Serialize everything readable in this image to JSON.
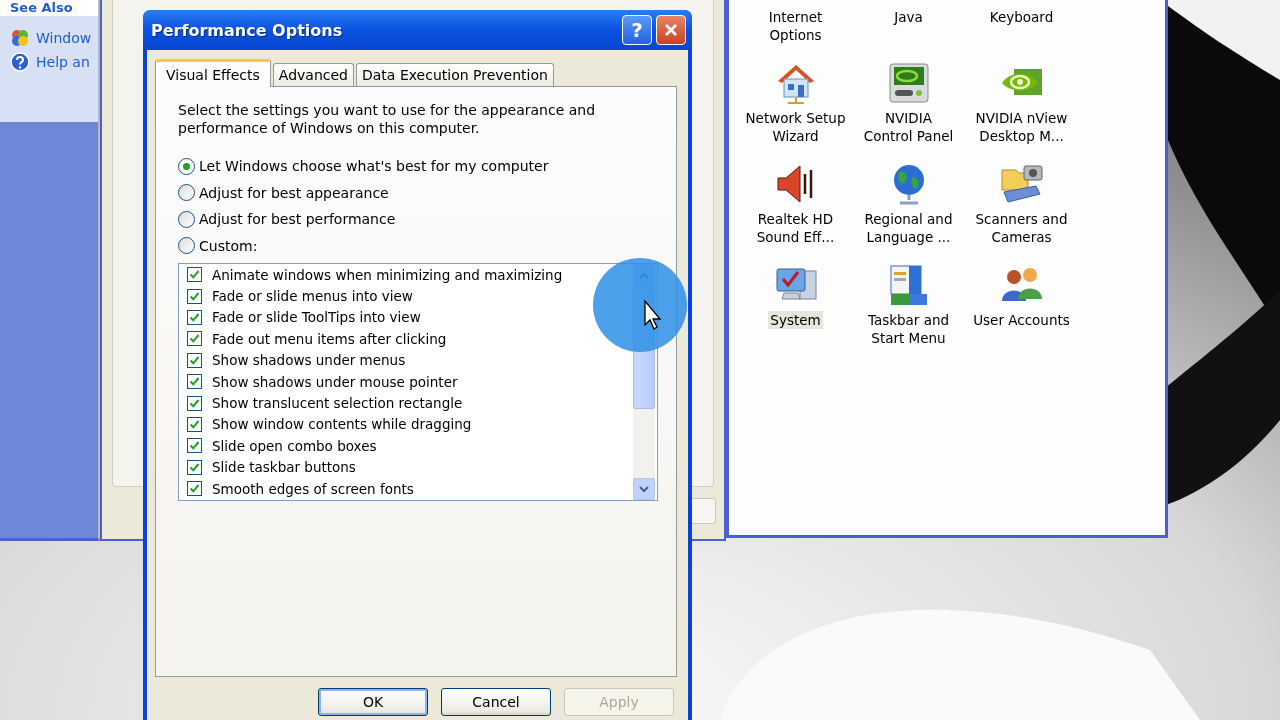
{
  "back_window": {
    "sidebar": {
      "heading": "See Also",
      "links": [
        {
          "label": "Window",
          "kind": "windows"
        },
        {
          "label": "Help an",
          "kind": "help"
        }
      ]
    }
  },
  "control_panel": {
    "items": [
      {
        "label": "Internet\nOptions",
        "selected": false
      },
      {
        "label": "Java",
        "selected": false
      },
      {
        "label": "Keyboard",
        "selected": false
      },
      {
        "label": "Network Setup\nWizard",
        "kind": "house",
        "selected": false
      },
      {
        "label": "NVIDIA\nControl Panel",
        "kind": "card",
        "selected": false
      },
      {
        "label": "NVIDIA nView\nDesktop M...",
        "kind": "eye",
        "selected": false
      },
      {
        "label": "Realtek HD\nSound Eff...",
        "kind": "speaker",
        "selected": false
      },
      {
        "label": "Regional and\nLanguage ...",
        "kind": "globe",
        "selected": false
      },
      {
        "label": "Scanners and\nCameras",
        "kind": "scanner",
        "selected": false
      },
      {
        "label": "System",
        "kind": "monitor",
        "selected": true
      },
      {
        "label": "Taskbar and\nStart Menu",
        "kind": "taskbar",
        "selected": false
      },
      {
        "label": "User Accounts",
        "kind": "people",
        "selected": false
      }
    ]
  },
  "dialog": {
    "title": "Performance Options",
    "help_button": "?",
    "tabs": [
      {
        "label": "Visual Effects",
        "selected": true
      },
      {
        "label": "Advanced",
        "selected": false
      },
      {
        "label": "Data Execution Prevention",
        "selected": false
      }
    ],
    "description": "Select the settings you want to use for the appearance and performance of Windows on this computer.",
    "options": [
      {
        "label": "Let Windows choose what's best for my computer",
        "selected": true
      },
      {
        "label": "Adjust for best appearance",
        "selected": false
      },
      {
        "label": "Adjust for best performance",
        "selected": false
      },
      {
        "label": "Custom:",
        "selected": false
      }
    ],
    "effects": [
      {
        "label": "Animate windows when minimizing and maximizing",
        "checked": true
      },
      {
        "label": "Fade or slide menus into view",
        "checked": true
      },
      {
        "label": "Fade or slide ToolTips into view",
        "checked": true
      },
      {
        "label": "Fade out menu items after clicking",
        "checked": true
      },
      {
        "label": "Show shadows under menus",
        "checked": true
      },
      {
        "label": "Show shadows under mouse pointer",
        "checked": true
      },
      {
        "label": "Show translucent selection rectangle",
        "checked": true
      },
      {
        "label": "Show window contents while dragging",
        "checked": true
      },
      {
        "label": "Slide open combo boxes",
        "checked": true
      },
      {
        "label": "Slide taskbar buttons",
        "checked": true
      },
      {
        "label": "Smooth edges of screen fonts",
        "checked": true
      }
    ],
    "buttons": [
      {
        "label": "OK",
        "default": true,
        "disabled": false
      },
      {
        "label": "Cancel",
        "default": false,
        "disabled": false
      },
      {
        "label": "Apply",
        "default": false,
        "disabled": true
      }
    ]
  }
}
